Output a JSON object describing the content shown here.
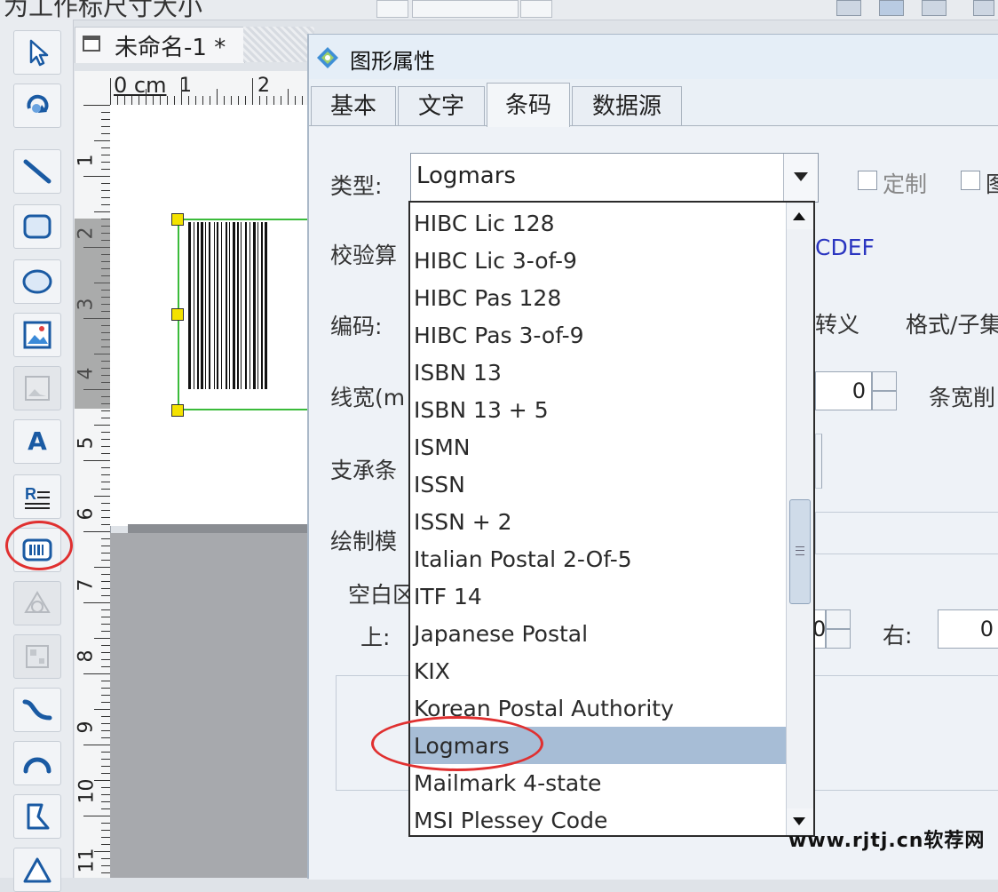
{
  "top_bar": {
    "title_fragment": "为工作标尺寸大小"
  },
  "document": {
    "tab_title": "未命名-1 *",
    "ruler_unit": "0 cm",
    "ruler_top_numbers": [
      "1",
      "2"
    ],
    "ruler_left_numbers": [
      "1",
      "2",
      "3",
      "4",
      "5",
      "6",
      "7",
      "8",
      "9",
      "10",
      "11"
    ]
  },
  "toolbar": {
    "items": [
      {
        "name": "pointer",
        "icon": "cursor-arrow-icon"
      },
      {
        "name": "rotate",
        "icon": "rotate-icon"
      },
      {
        "name": "line",
        "icon": "line-icon"
      },
      {
        "name": "rounded-rectangle",
        "icon": "rounded-rect-icon"
      },
      {
        "name": "ellipse",
        "icon": "ellipse-icon"
      },
      {
        "name": "image",
        "icon": "image-icon"
      },
      {
        "name": "image-disabled",
        "icon": "image-icon"
      },
      {
        "name": "text",
        "icon": "text-icon",
        "glyph": "A"
      },
      {
        "name": "rich-text",
        "icon": "rich-text-icon",
        "glyph": "R"
      },
      {
        "name": "barcode",
        "icon": "barcode-icon"
      },
      {
        "name": "shape-disabled",
        "icon": "shape-icon"
      },
      {
        "name": "qrcode-disabled",
        "icon": "qrcode-icon"
      },
      {
        "name": "curve",
        "icon": "curve-icon"
      },
      {
        "name": "arc",
        "icon": "arc-icon"
      },
      {
        "name": "polygon",
        "icon": "polygon-icon"
      },
      {
        "name": "triangle",
        "icon": "triangle-icon"
      }
    ]
  },
  "dialog": {
    "title": "图形属性",
    "tabs": [
      {
        "label": "基本",
        "active": false
      },
      {
        "label": "文字",
        "active": false
      },
      {
        "label": "条码",
        "active": true
      },
      {
        "label": "数据源",
        "active": false
      }
    ],
    "labels": {
      "type": "类型:",
      "checksum": "校验算",
      "encoding": "编码:",
      "line_width": "线宽(m",
      "bearer": "支承条",
      "draw_mode": "绘制模",
      "quiet_zone": "空白区",
      "top": "上:",
      "right": "右:",
      "escape": "转义",
      "format": "格式/子集",
      "bar_width_reduction": "条宽削",
      "charset_fragment": "CDEF"
    },
    "type_value": "Logmars",
    "checkboxes": [
      {
        "label": "定制",
        "checked": false
      },
      {
        "label": "图",
        "checked": false
      }
    ],
    "line_width_value": "0",
    "top_value": "0",
    "right_value": "0"
  },
  "dropdown": {
    "selected": "Logmars",
    "options": [
      "HIBC Lic 128",
      "HIBC Lic 3-of-9",
      "HIBC Pas 128",
      "HIBC Pas 3-of-9",
      "ISBN 13",
      "ISBN 13 + 5",
      "ISMN",
      "ISSN",
      "ISSN + 2",
      "Italian Postal 2-Of-5",
      "ITF 14",
      "Japanese Postal",
      "KIX",
      "Korean Postal Authority",
      "Logmars",
      "Mailmark 4-state",
      "MSI Plessey Code"
    ]
  },
  "watermark": "www.rjtj.cn软荐网",
  "colors": {
    "highlight_ring": "#e03030",
    "selected_row": "#a7bdd6",
    "selection_border": "#3bbb3b",
    "selection_handle": "#f4e200"
  }
}
